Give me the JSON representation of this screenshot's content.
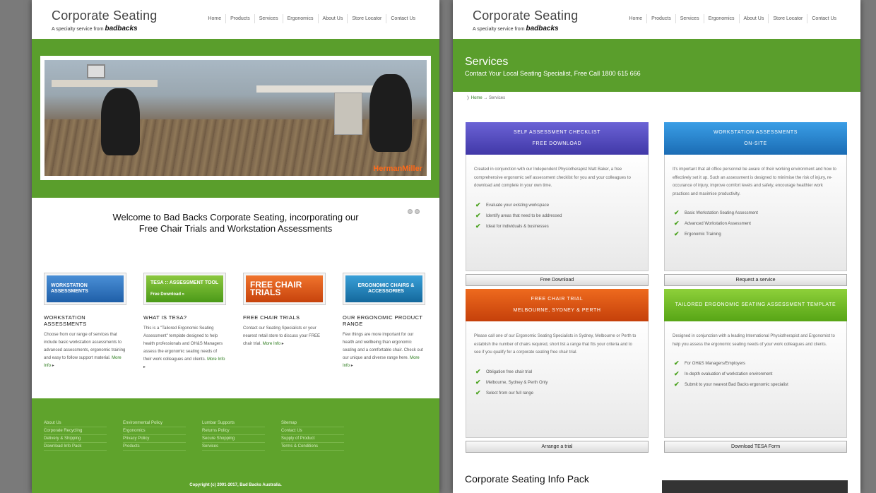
{
  "header": {
    "title": "Corporate Seating",
    "subtitle": "A specialty service from",
    "brand": "badbacks",
    "nav": [
      "Home",
      "Products",
      "Services",
      "Ergonomics",
      "About Us",
      "Store Locator",
      "Contact Us"
    ]
  },
  "hero": {
    "brand_watermark": "HermanMiller"
  },
  "welcome": {
    "line1": "Welcome to Bad Backs Corporate Seating, incorporating our",
    "line2": "Free Chair Trials and Workstation Assessments"
  },
  "promos": [
    {
      "badge": "WORKSTATION ASSESSMENTS",
      "title": "WORKSTATION ASSESSMENTS",
      "text": "Choose from our range of services that include basic workstation assessments to advanced assessments, ergonomic training and easy to follow support material.",
      "more": "More Info"
    },
    {
      "badge": "TESA :: ASSESSMENT TOOL",
      "badge_sub": "Free Download »",
      "title": "WHAT IS TESA?",
      "text": "This is a \"Tailored Ergonomic Seating Assessment\" template designed to help health professionals and OH&S Managers assess the ergonomic seating needs of their work colleagues and clients.",
      "more": "More Info"
    },
    {
      "badge": "FREE CHAIR TRIALS",
      "title": "FREE CHAIR TRIALS",
      "text": "Contact our Seating Specialists or your nearest retail store to discuss your FREE chair trial.",
      "more": "More Info"
    },
    {
      "badge": "ERGONOMIC CHAIRS & ACCESSORIES",
      "title": "OUR ERGONOMIC PRODUCT RANGE",
      "text": "Few things are more important for our health and wellbeing than ergonomic seating and a comfortable chair. Check out our unique and diverse range here.",
      "more": "More Info"
    }
  ],
  "footer": {
    "columns": [
      [
        "About Us",
        "Corporate Recycling",
        "Delivery & Shipping",
        "Download Info Pack"
      ],
      [
        "Environmental Policy",
        "Ergonomics",
        "Privacy Policy",
        "Products"
      ],
      [
        "Lumbar Supports",
        "Returns Policy",
        "Secure Shopping",
        "Services"
      ],
      [
        "Sitemap",
        "Contact Us",
        "Supply of Product",
        "Terms & Conditions"
      ]
    ],
    "copyright": "Copyright (c) 2001-2017, Bad Backs Australia."
  },
  "services": {
    "title": "Services",
    "subtitle": "Contact Your Local Seating Specialist, Free Call 1800 615 666",
    "breadcrumb_home": "Home",
    "breadcrumb_current": "→ Services",
    "boxes": [
      {
        "head1": "SELF ASSESSMENT CHECKLIST",
        "head2": "FREE DOWNLOAD",
        "text": "Created in conjunction with our Independent Physiotherapist Matt Baker, a free comprehensive ergonomic self assessment checklist for you and your colleagues to download and complete in your own time.",
        "items": [
          "Evaluate your existing workspace",
          "Identify areas that need to be addressed",
          "Ideal for individuals & businesses"
        ],
        "button": "Free Download"
      },
      {
        "head1": "WORKSTATION ASSESSMENTS",
        "head2": "ON-SITE",
        "text": "It's important that all office personnel be aware of their working environment and how to effectively set it up. Such an assessment is designed to minimise the risk of injury, re-occurance of injury, improve comfort levels and safety, encourage healthier work practices and maximise productivity.",
        "items": [
          "Basic Workstation Seating Assessment",
          "Advanced Workstation Assessment",
          "Ergonomic Training"
        ],
        "button": "Request a service"
      },
      {
        "head1": "FREE CHAIR TRIAL",
        "head2": "MELBOURNE, SYDNEY & PERTH",
        "text": "Please call one of our Ergonomic Seating Specialists in Sydney, Melbourne or Perth to establish the number of chairs required, short list a range that fits your criteria and to see if you qualify for a corporate seating free chair trial.",
        "items": [
          "Obligation free chair trial",
          "Melbourne, Sydney & Perth Only",
          "Select from our full range"
        ],
        "button": "Arrange a trial"
      },
      {
        "head1": "TAILORED ERGONOMIC SEATING ASSESSMENT TEMPLATE",
        "head2": "",
        "text": "Designed in conjunction with a leading International Physiotherapist and Ergonomist to help you assess the ergonomic seating needs of your work colleagues and clients.",
        "items": [
          "For OH&S Managers/Employers",
          "In-depth evaluation of workstation environment",
          "Submit to your nearest Bad Backs ergonomic specialist"
        ],
        "button": "Download TESA Form"
      }
    ],
    "info_pack": "Corporate Seating Info Pack"
  }
}
